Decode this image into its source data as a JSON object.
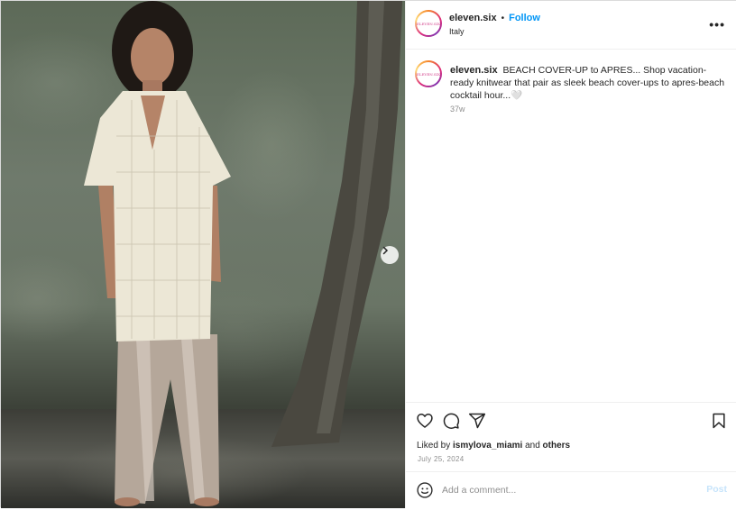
{
  "post": {
    "username": "eleven.six",
    "follow_label": "Follow",
    "separator": "•",
    "location": "Italy",
    "avatar_text": "ELEVEN.SIX",
    "more_label": "•••"
  },
  "caption": {
    "username": "eleven.six",
    "text": "BEACH COVER-UP to APRES... Shop vacation-ready knitwear that pair as sleek beach cover-ups to apres-beach cocktail hour...🤍",
    "time": "37w"
  },
  "engagement": {
    "liked_prefix": "Liked by",
    "liked_user": "ismylova_miami",
    "liked_mid": "and",
    "liked_others": "others",
    "date": "July 25, 2024"
  },
  "comment": {
    "placeholder": "Add a comment...",
    "post_label": "Post"
  },
  "icons": {
    "like": "heart-icon",
    "comment": "comment-icon",
    "share": "share-icon",
    "save": "bookmark-icon",
    "emoji": "emoji-icon",
    "next": "chevron-right-icon",
    "more": "more-icon"
  },
  "colors": {
    "follow": "#0095f6",
    "post_disabled": "#c7e4fb",
    "muted": "#8e8e8e"
  }
}
